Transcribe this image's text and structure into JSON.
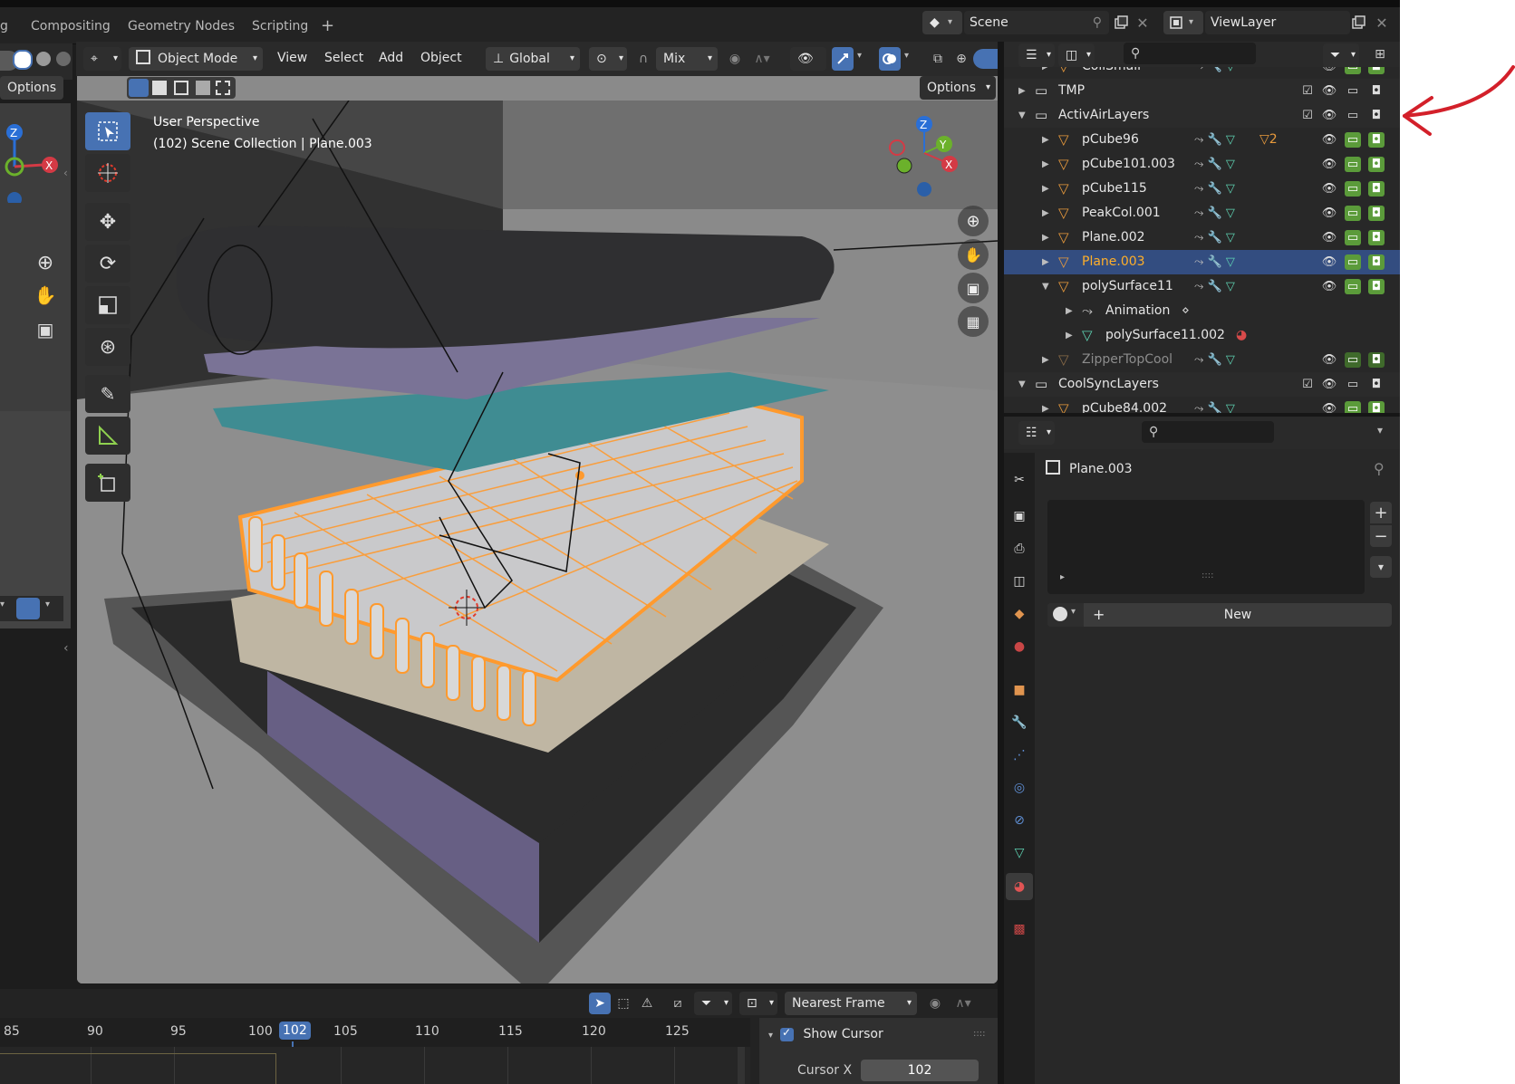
{
  "topbar": {
    "workspace_tabs": [
      "g",
      "Compositing",
      "Geometry Nodes",
      "Scripting",
      "+"
    ],
    "scene_name": "Scene",
    "view_layer": "ViewLayer"
  },
  "left_panel": {
    "options_label": "Options"
  },
  "viewport_header": {
    "mode": "Object Mode",
    "menus": [
      "View",
      "Select",
      "Add",
      "Object"
    ],
    "orientation": "Global",
    "snap_mode": "Mix",
    "options_label": "Options"
  },
  "viewport": {
    "perspective_label": "User Perspective",
    "collection_info": "(102) Scene Collection | Plane.003",
    "gizmo_axes": {
      "z": "Z",
      "y": "Y",
      "x": "X"
    },
    "accent_selected": "#ff9a2e"
  },
  "outliner": {
    "rows": [
      {
        "label": "CollSmall",
        "type": "object",
        "depth": 2
      },
      {
        "label": "TMP",
        "type": "collection",
        "depth": 1
      },
      {
        "label": "ActivAirLayers",
        "type": "collection",
        "depth": 1,
        "expanded": true
      },
      {
        "label": "pCube96",
        "type": "object",
        "depth": 2,
        "extra": "2"
      },
      {
        "label": "pCube101.003",
        "type": "object",
        "depth": 2
      },
      {
        "label": "pCube115",
        "type": "object",
        "depth": 2
      },
      {
        "label": "PeakCol.001",
        "type": "object",
        "depth": 2
      },
      {
        "label": "Plane.002",
        "type": "object",
        "depth": 2
      },
      {
        "label": "Plane.003",
        "type": "object",
        "depth": 2,
        "selected": true
      },
      {
        "label": "polySurface11",
        "type": "object",
        "depth": 2,
        "expanded": true
      },
      {
        "label": "Animation",
        "type": "data",
        "depth": 3
      },
      {
        "label": "polySurface11.002",
        "type": "mesh",
        "depth": 3
      },
      {
        "label": "ZipperTopCool",
        "type": "object",
        "depth": 2,
        "dim": true
      },
      {
        "label": "CoolSyncLayers",
        "type": "collection",
        "depth": 1,
        "expanded": true
      },
      {
        "label": "pCube84.002",
        "type": "object",
        "depth": 2
      }
    ],
    "colors": {
      "selected_row": "#334d80",
      "selected_text": "#ffaf29",
      "object_icon": "#e89a3c",
      "mesh_icon": "#5ed3b3",
      "modifier_icon": "#5f8fd6",
      "visibility_on": "#5b9b3a"
    }
  },
  "properties": {
    "object_name": "Plane.003",
    "new_button": "New"
  },
  "timeline": {
    "ticks": [
      "85",
      "90",
      "95",
      "100",
      "102",
      "105",
      "110",
      "115",
      "120",
      "125"
    ],
    "current_frame": "102",
    "snap_mode": "Nearest Frame",
    "show_cursor_label": "Show Cursor",
    "cursor_x_label": "Cursor X",
    "cursor_x_value": "102"
  }
}
